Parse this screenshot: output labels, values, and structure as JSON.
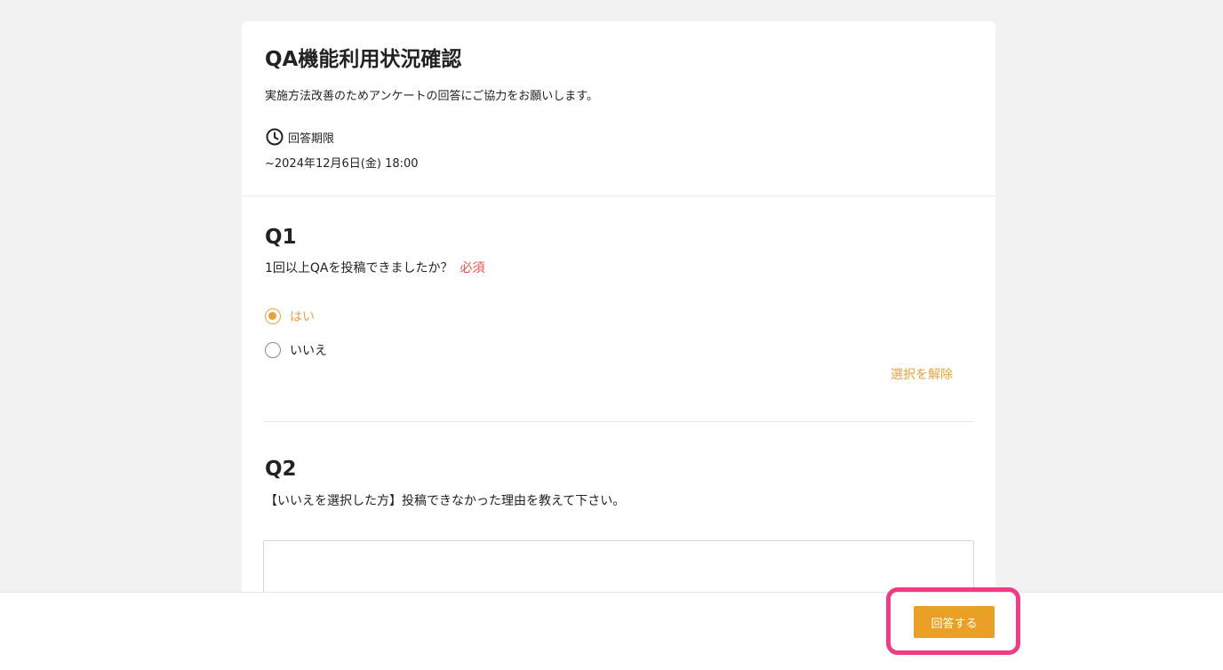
{
  "survey": {
    "title": "QA機能利用状況確認",
    "description": "実施方法改善のためアンケートの回答にご協力をお願いします。",
    "deadline_label": "回答期限",
    "deadline_value": "~2024年12月6日(金) 18:00",
    "clock_icon": "clock-icon"
  },
  "questions": [
    {
      "number": "Q1",
      "text": "1回以上QAを投稿できましたか？",
      "required_label": "必須",
      "options": [
        {
          "label": "はい",
          "selected": true
        },
        {
          "label": "いいえ",
          "selected": false
        }
      ],
      "clear_label": "選択を解除"
    },
    {
      "number": "Q2",
      "text": "【いいえを選択した方】投稿できなかった理由を教えて下さい。",
      "answer_value": ""
    }
  ],
  "footer": {
    "submit_label": "回答する"
  },
  "colors": {
    "accent": "#eaa027",
    "required": "#e8504b",
    "highlight": "#ef3c83"
  }
}
